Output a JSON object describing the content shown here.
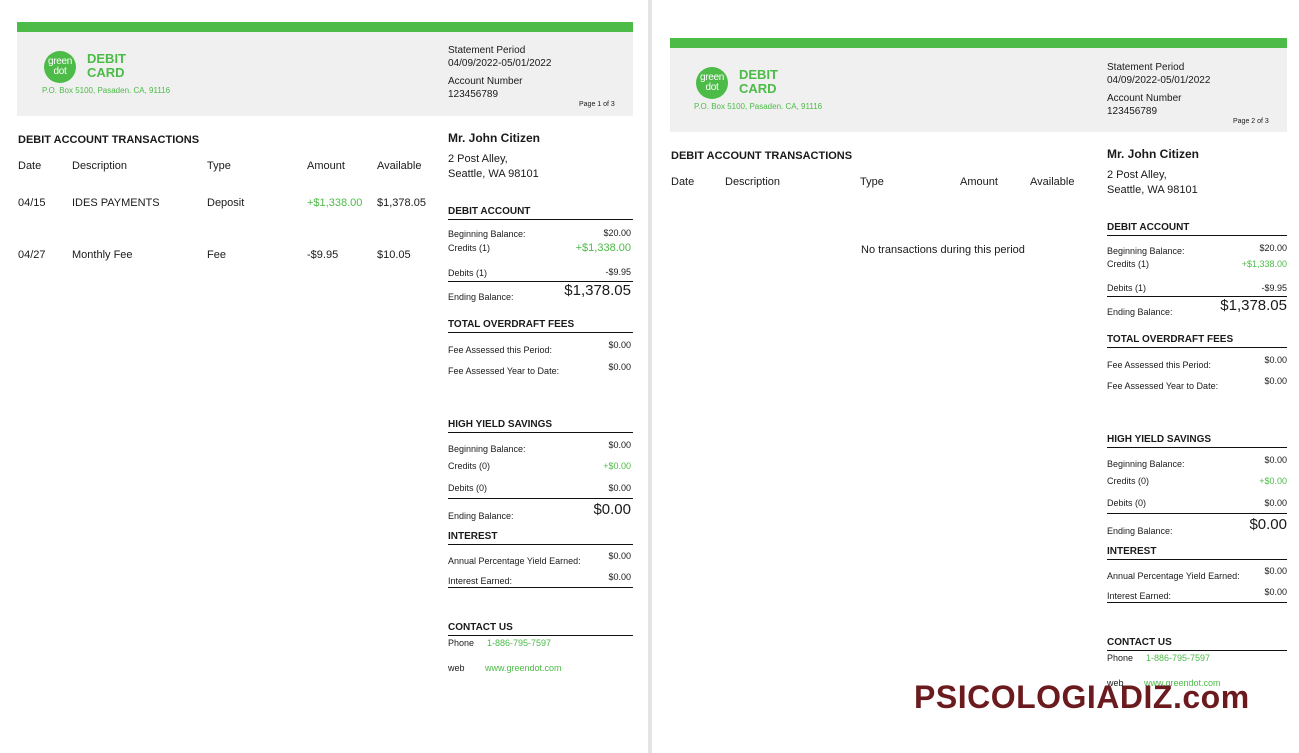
{
  "brand": {
    "logo_text": "green dot",
    "line1": "DEBIT",
    "line2": "CARD",
    "address": "P.O. Box 5100, Pasaden. CA, 91116"
  },
  "statement": {
    "period_label": "Statement Period",
    "period_value": "04/09/2022-05/01/2022",
    "account_label": "Account Number",
    "account_value": "123456789"
  },
  "pages": [
    {
      "page_label": "Page 1 of 3"
    },
    {
      "page_label": "Page 2 of 3"
    }
  ],
  "transactions": {
    "title": "DEBIT ACCOUNT TRANSACTIONS",
    "columns": [
      "Date",
      "Description",
      "Type",
      "Amount",
      "Available"
    ],
    "rows": [
      {
        "date": "04/15",
        "description": "IDES PAYMENTS",
        "type": "Deposit",
        "amount": "+$1,338.00",
        "available": "$1,378.05"
      },
      {
        "date": "04/27",
        "description": "Monthly Fee",
        "type": "Fee",
        "amount": "-$9.95",
        "available": "$10.05"
      }
    ],
    "empty_message": "No transactions during this period"
  },
  "customer": {
    "name": "Mr. John Citizen",
    "address_line1": "2 Post Alley,",
    "address_line2": "Seattle, WA 98101"
  },
  "debit_account": {
    "title": "DEBIT ACCOUNT",
    "beginning_label": "Beginning Balance:",
    "beginning_value": "$20.00",
    "credits_label": "Credits (1)",
    "credits_value": "+$1,338.00",
    "debits_label": "Debits (1)",
    "debits_value": "-$9.95",
    "ending_label": "Ending Balance:",
    "ending_value": "$1,378.05"
  },
  "overdraft": {
    "title": "TOTAL OVERDRAFT FEES",
    "period_label": "Fee Assessed this Period:",
    "period_value": "$0.00",
    "ytd_label": "Fee Assessed Year to Date:",
    "ytd_value": "$0.00"
  },
  "savings": {
    "title": "HIGH YIELD SAVINGS",
    "beginning_label": "Beginning Balance:",
    "beginning_value": "$0.00",
    "credits_label": "Credits (0)",
    "credits_value": "+$0.00",
    "debits_label": "Debits (0)",
    "debits_value": "$0.00",
    "ending_label": "Ending Balance:",
    "ending_value": "$0.00"
  },
  "interest": {
    "title": "INTEREST",
    "apy_label": "Annual Percentage Yield Earned:",
    "apy_value": "$0.00",
    "earned_label": "Interest Earned:",
    "earned_value": "$0.00"
  },
  "contact": {
    "title": "CONTACT US",
    "phone_label": "Phone",
    "phone_value": "1-886-795-7597",
    "web_label": "web",
    "web_value": "www.greendot.com"
  },
  "watermark": "PSICOLOGIADIZ.com",
  "colors": {
    "accent": "#4cbb47",
    "header_bg": "#f0f0f0",
    "watermark": "#6b1a1e"
  }
}
